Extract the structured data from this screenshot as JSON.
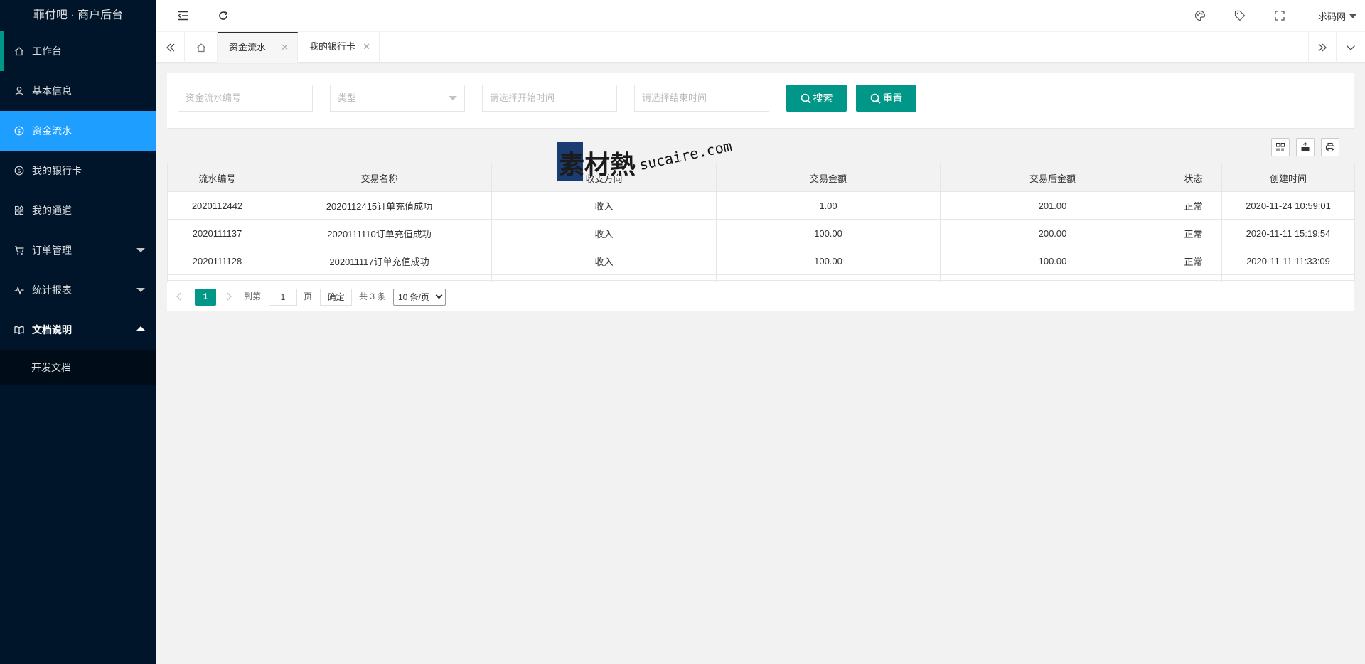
{
  "app": {
    "title": "菲付吧 · 商户后台"
  },
  "sidebar": {
    "items": [
      {
        "label": "工作台"
      },
      {
        "label": "基本信息"
      },
      {
        "label": "资金流水"
      },
      {
        "label": "我的银行卡"
      },
      {
        "label": "我的通道"
      },
      {
        "label": "订单管理"
      },
      {
        "label": "统计报表"
      },
      {
        "label": "文档说明"
      }
    ],
    "submenu": [
      {
        "label": "开发文档"
      }
    ]
  },
  "header": {
    "user": "求码网"
  },
  "tabs": [
    {
      "label": "资金流水"
    },
    {
      "label": "我的银行卡"
    }
  ],
  "search": {
    "serial_placeholder": "资金流水编号",
    "type_placeholder": "类型",
    "start_placeholder": "请选择开始时间",
    "end_placeholder": "请选择结束时间",
    "search_label": "搜索",
    "reset_label": "重置"
  },
  "table": {
    "headers": [
      "流水编号",
      "交易名称",
      "收支方向",
      "交易金额",
      "交易后金额",
      "状态",
      "创建时间"
    ],
    "rows": [
      [
        "2020112442",
        "2020112415订单充值成功",
        "收入",
        "1.00",
        "201.00",
        "正常",
        "2020-11-24 10:59:01"
      ],
      [
        "2020111137",
        "2020111110订单充值成功",
        "收入",
        "100.00",
        "200.00",
        "正常",
        "2020-11-11 15:19:54"
      ],
      [
        "2020111128",
        "202011117订单充值成功",
        "收入",
        "100.00",
        "100.00",
        "正常",
        "2020-11-11 11:33:09"
      ]
    ]
  },
  "pager": {
    "current": "1",
    "goto_label": "到第",
    "page_input": "1",
    "page_unit": "页",
    "confirm": "确定",
    "total": "共 3 条",
    "page_size": "10 条/页"
  },
  "watermark": {
    "cn": "素材熱",
    "en": "sucaire.com"
  },
  "colors": {
    "sidebar_bg": "#001529",
    "active_menu": "#1e9fff",
    "primary": "#009688"
  }
}
